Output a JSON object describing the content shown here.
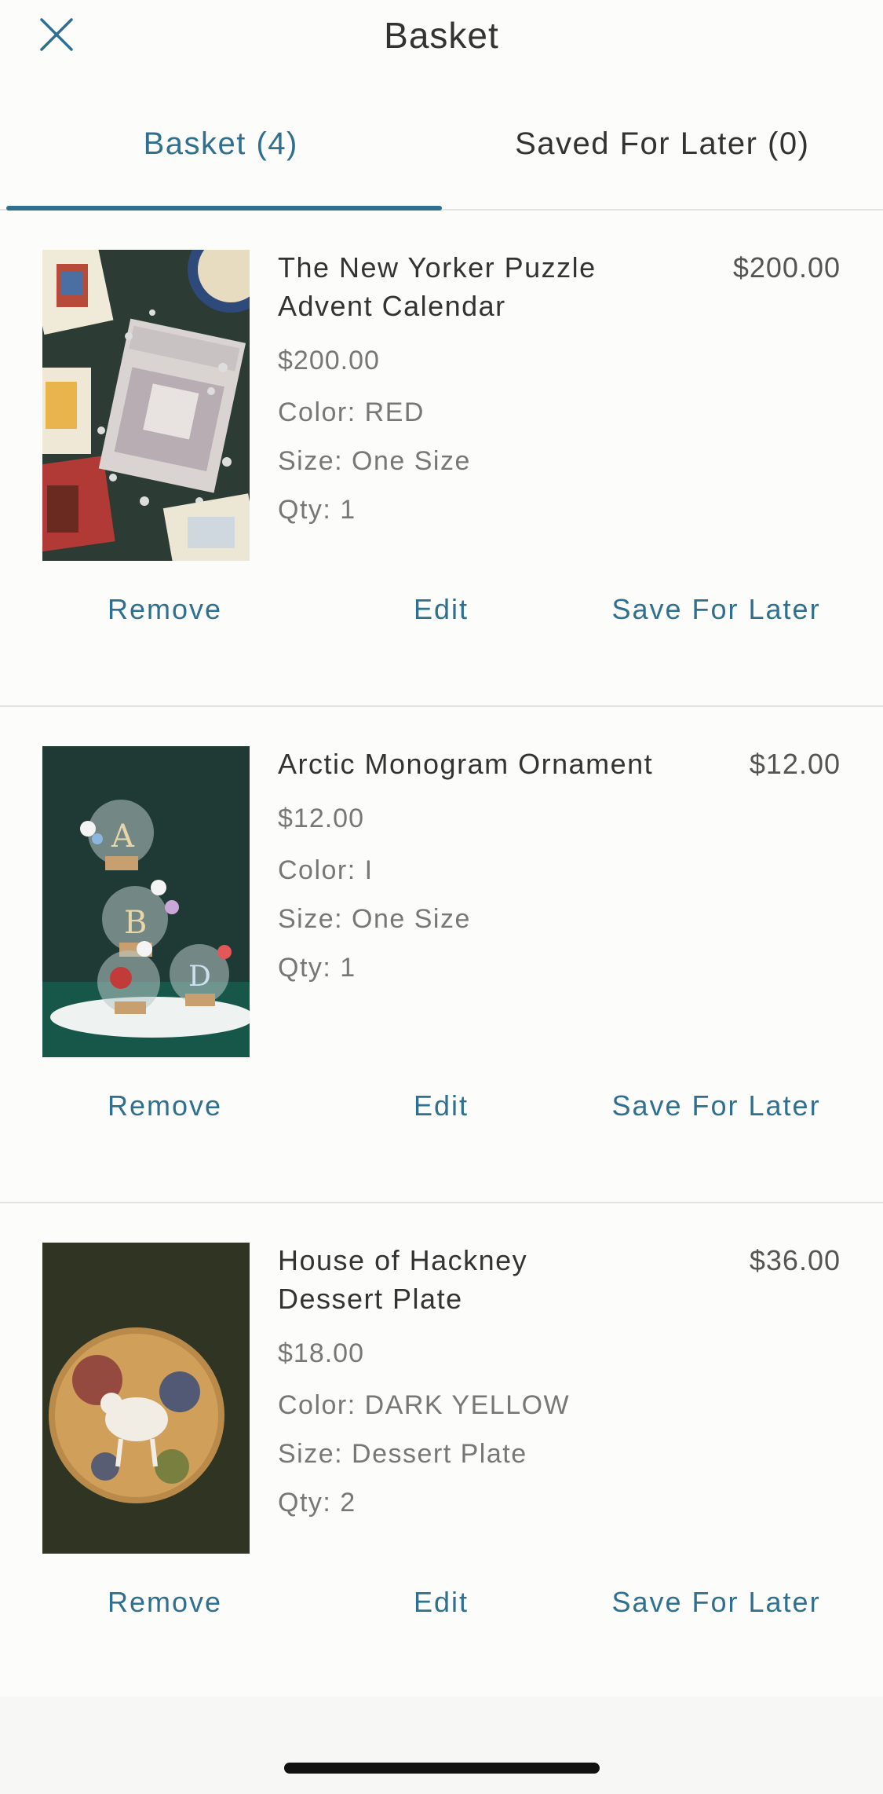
{
  "header": {
    "title": "Basket"
  },
  "tabs": [
    {
      "label": "Basket (4)"
    },
    {
      "label": "Saved For Later (0)"
    }
  ],
  "actions": {
    "remove": "Remove",
    "edit": "Edit",
    "save_for_later": "Save For Later"
  },
  "items": [
    {
      "name_line1": "The New Yorker Puzzle",
      "name_line2": "Advent Calendar",
      "unit_price": "$200.00",
      "total": "$200.00",
      "color": "Color: RED",
      "size": "Size: One Size",
      "qty": "Qty: 1"
    },
    {
      "name_line1": "Arctic Monogram Ornament",
      "name_line2": "",
      "unit_price": "$12.00",
      "total": "$12.00",
      "color": "Color: I",
      "size": "Size: One Size",
      "qty": "Qty: 1"
    },
    {
      "name_line1": "House of Hackney",
      "name_line2": "Dessert Plate",
      "unit_price": "$18.00",
      "total": "$36.00",
      "color": "Color: DARK YELLOW",
      "size": "Size: Dessert Plate",
      "qty": "Qty: 2"
    }
  ],
  "colors": {
    "accent": "#2f6f8f",
    "text": "#333333",
    "muted": "#777777",
    "background": "#fcfcfa"
  }
}
